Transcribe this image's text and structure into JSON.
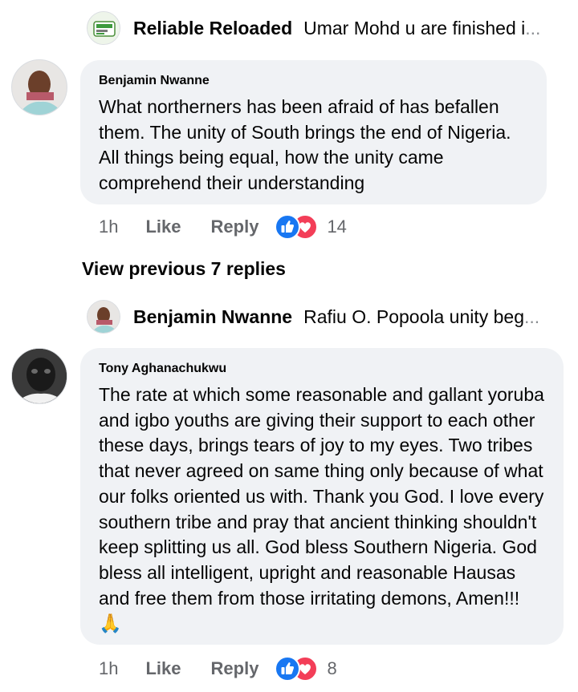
{
  "replies_top": {
    "name": "Reliable Reloaded",
    "snippet": "Umar Mohd u are finished i",
    "ellipsis": "..."
  },
  "comment1": {
    "author": "Benjamin Nwanne",
    "text": "What northerners has been afraid of has befallen them. The unity of South brings the end of Nigeria. All things being equal, how the unity came comprehend their understanding",
    "time": "1h",
    "like_label": "Like",
    "reply_label": "Reply",
    "reaction_count": "14",
    "reactions": [
      "like-icon",
      "love-icon"
    ]
  },
  "view_previous": "View previous 7 replies",
  "replies_mid": {
    "name": "Benjamin Nwanne",
    "snippet": "Rafiu O. Popoola unity beg",
    "ellipsis": "..."
  },
  "comment2": {
    "author": "Tony Aghanachukwu",
    "text": "The rate at which some reasonable and gallant yoruba and igbo youths are giving their support to each other these days, brings tears of joy to my eyes. Two tribes that never agreed on same thing only because of what our folks oriented us with. Thank you God. I love every southern tribe and pray that ancient thinking shouldn't keep splitting us all. God bless Southern Nigeria. God bless all intelligent, upright and reasonable Hausas and free them from those irritating demons, Amen!!!",
    "emoji": "🙏",
    "time": "1h",
    "like_label": "Like",
    "reply_label": "Reply",
    "reaction_count": "8",
    "reactions": [
      "like-icon",
      "love-icon"
    ]
  },
  "colors": {
    "bubble": "#f0f2f5",
    "meta": "#65676b",
    "like_blue": "#1877f2",
    "love_red": "#f33e58"
  }
}
